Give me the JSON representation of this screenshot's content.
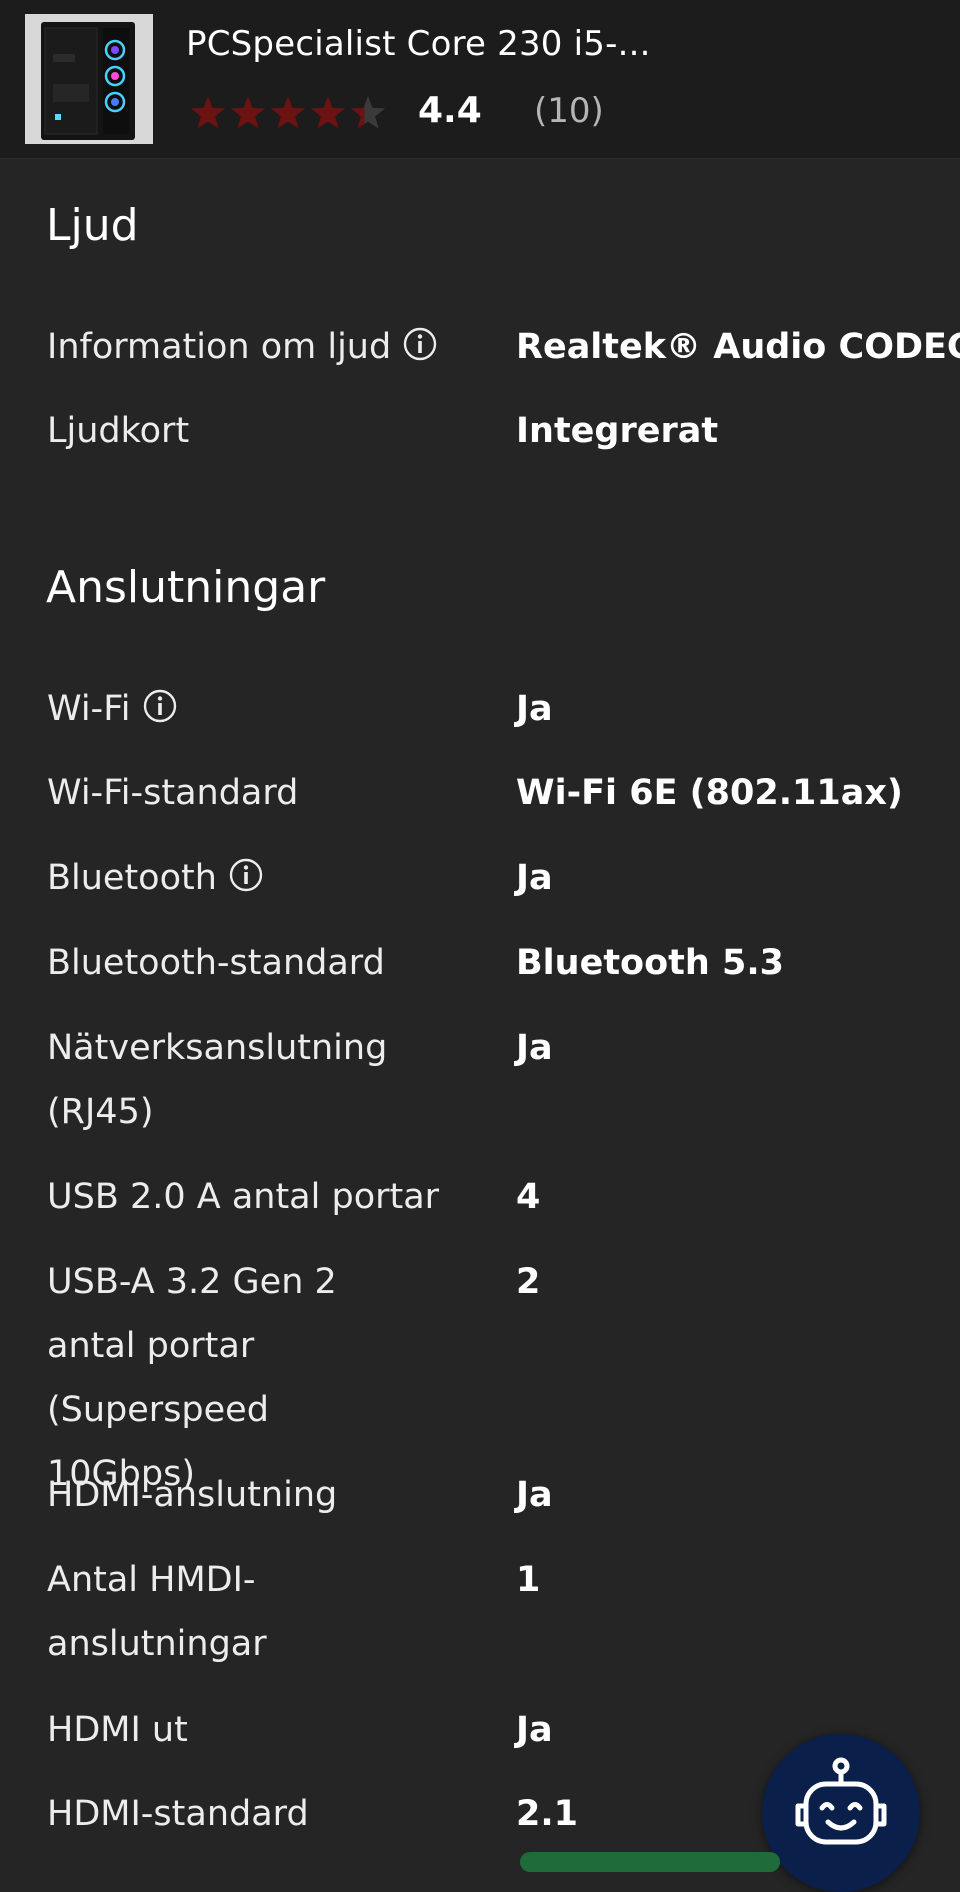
{
  "header": {
    "product_title": "PCSpecialist Core 230 i5-...",
    "rating": "4.4",
    "rating_fraction": 0.88,
    "review_count": "(10)",
    "star_color": "#6b1212",
    "star_empty_color": "#3a3a3a"
  },
  "sections": [
    {
      "title": "Ljud",
      "rows": [
        {
          "label": "Information om ljud",
          "value": "Realtek® Audio CODEC",
          "info": true
        },
        {
          "label": "Ljudkort",
          "value": "Integrerat",
          "info": false
        }
      ]
    },
    {
      "title": "Anslutningar",
      "rows": [
        {
          "label": "Wi-Fi",
          "value": "Ja",
          "info": true
        },
        {
          "label": "Wi-Fi-standard",
          "value": "Wi-Fi 6E (802.11ax)",
          "info": false
        },
        {
          "label": "Bluetooth",
          "value": "Ja",
          "info": true
        },
        {
          "label": "Bluetooth-standard",
          "value": "Bluetooth 5.3",
          "info": false
        },
        {
          "label": "Nätverksanslutning (RJ45)",
          "value": "Ja",
          "info": false
        },
        {
          "label": "USB 2.0 A antal portar",
          "value": "4",
          "info": false
        },
        {
          "label": "USB-A 3.2 Gen 2 antal portar (Superspeed 10Gbps)",
          "value": "2",
          "info": false
        },
        {
          "label": "HDMI-anslutning",
          "value": "Ja",
          "info": false
        },
        {
          "label": "Antal HMDI-anslutningar",
          "value": "1",
          "info": false
        },
        {
          "label": "HDMI ut",
          "value": "Ja",
          "info": false
        },
        {
          "label": "HDMI-standard",
          "value": "2.1",
          "info": false
        }
      ]
    }
  ],
  "colors": {
    "background": "#252525",
    "header_background": "#1c1c1c",
    "bot_button": "#0a1f4a"
  },
  "icons": {
    "info": "info-circle-icon",
    "bot": "robot-assistant-icon",
    "thumbnail": "pc-tower-thumbnail"
  }
}
